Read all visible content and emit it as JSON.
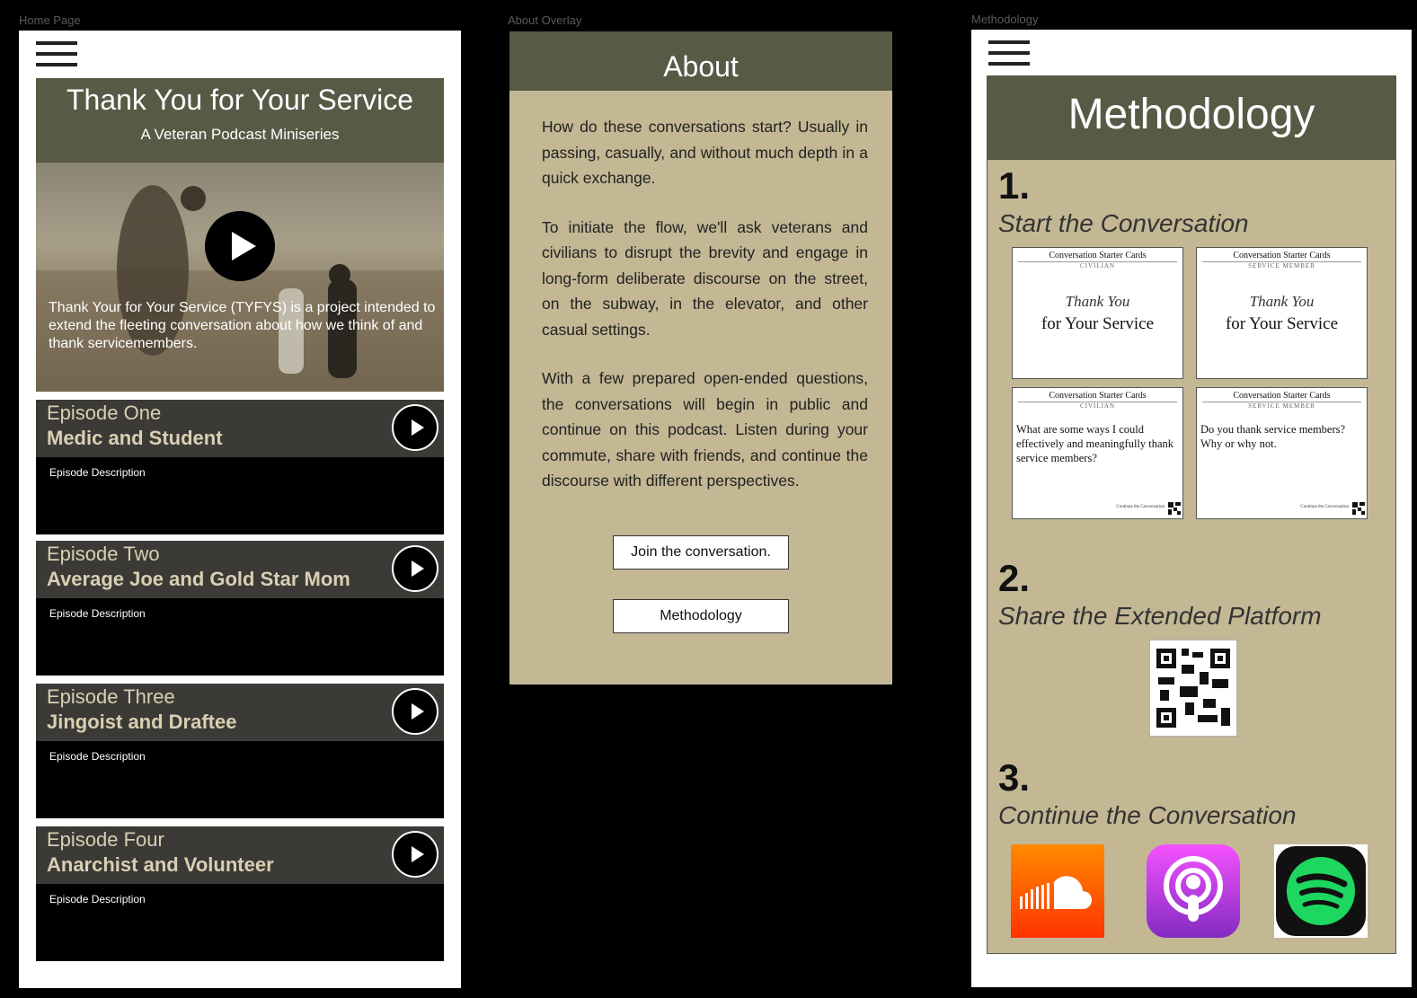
{
  "frames": {
    "home_label": "Home Page",
    "about_label": "About Overlay",
    "methodology_label": "Methodology"
  },
  "home": {
    "title": "Thank You for Your Service",
    "subtitle": "A Veteran Podcast Miniseries",
    "hero_caption": "Thank Your for Your Service (TYFYS) is a project intended to extend the fleeting conversation about how we think of and thank servicemembers.",
    "episodes": [
      {
        "number": "Episode One",
        "name": "Medic and Student",
        "description": "Episode Description"
      },
      {
        "number": "Episode Two",
        "name": "Average Joe and Gold Star Mom",
        "description": "Episode Description"
      },
      {
        "number": "Episode Three",
        "name": "Jingoist and Draftee",
        "description": "Episode Description"
      },
      {
        "number": "Episode Four",
        "name": "Anarchist and Volunteer",
        "description": "Episode Description"
      }
    ]
  },
  "about": {
    "title": "About",
    "paragraphs": [
      "How do these conversations start? Usually in passing, casually, and without much depth in a quick exchange.",
      "To initiate the flow, we'll ask veterans and civilians to disrupt the brevity and engage in long-form deliberate discourse on the street, on the subway, in the elevator, and other casual settings.",
      "With a few prepared open-ended questions, the conversations will begin in public and continue on this podcast. Listen during your commute, share with friends, and continue the discourse with different perspectives."
    ],
    "join_button": "Join the conversation.",
    "methodology_button": "Methodology"
  },
  "methodology": {
    "title": "Methodology",
    "steps": [
      {
        "number": "1.",
        "title": "Start the Conversation"
      },
      {
        "number": "2.",
        "title": "Share the Extended Platform"
      },
      {
        "number": "3.",
        "title": "Continue the Conversation"
      }
    ],
    "cards": [
      {
        "header": "Conversation Starter Cards",
        "audience": "CIVILIAN",
        "thank": "Thank You",
        "service": "for Your Service"
      },
      {
        "header": "Conversation Starter Cards",
        "audience": "SERVICE MEMBER",
        "thank": "Thank You",
        "service": "for Your Service"
      },
      {
        "header": "Conversation Starter Cards",
        "audience": "CIVILIAN",
        "question": "What are some ways I could effectively and meaningfully thank service members?",
        "footer": "Continue the Conversation"
      },
      {
        "header": "Conversation Starter Cards",
        "audience": "SERVICE MEMBER",
        "question": "Do you thank service members? Why or why not.",
        "footer": "Continue the Conversation"
      }
    ],
    "platforms": [
      "soundcloud-icon",
      "apple-podcasts-icon",
      "spotify-icon"
    ]
  },
  "colors": {
    "olive": "#585a46",
    "tan": "#c3b794",
    "episode_header": "#3c3a37",
    "episode_text": "#d9cfb2"
  }
}
